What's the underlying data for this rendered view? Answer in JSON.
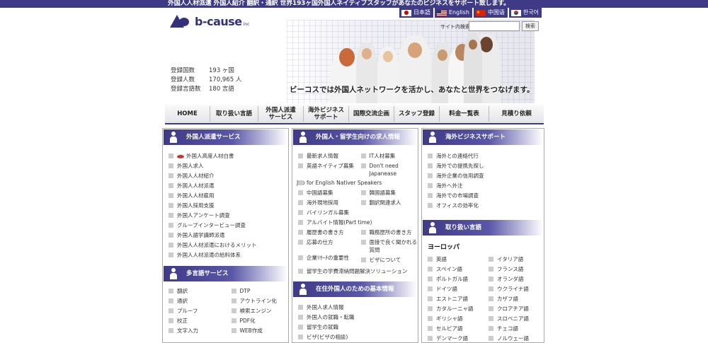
{
  "header": {
    "top_message": "外国人人材派遣 外国人紹介 翻訳・通訳 世界193ヶ国外国人ネイティブスタッフがあなたのビジネスをサポート致します。",
    "languages": [
      "日本語",
      "English",
      "中国语",
      "한국어"
    ],
    "logo_text": "b-cause",
    "logo_suffix": "inc",
    "search_label": "サイト内検索",
    "search_value": "",
    "search_button": "検索",
    "tagline": "ビーコスでは外国人ネットワークを活かし、あなたと世界をつなげます。"
  },
  "stats": [
    {
      "label": "登録国数",
      "value": "193 ヶ国"
    },
    {
      "label": "登録人数",
      "value": "170,965 人"
    },
    {
      "label": "登録言語数",
      "value": "180 言語"
    }
  ],
  "nav": [
    "HOME",
    "取り扱い言語",
    "外国人派遣\nサービス",
    "海外ビジネス\nサポート",
    "国際交流企画",
    "スタッフ登録",
    "料金一覧表",
    "見積り依頼"
  ],
  "col1": {
    "dispatch_title": "外国人派遣サービス",
    "dispatch_links": [
      "外国人高度人材白書",
      "外国人求人",
      "外国人人材紹介",
      "外国人人材派遣",
      "外国人人材雇用",
      "外国人採用支援",
      "外国人アンケート調査",
      "グループインタービュー調査",
      "外国人語学講師派遣",
      "外国人人材派遣におけるメリット",
      "外国人人材派遣の給料体系"
    ],
    "multi_title": "多言語サービス",
    "multi_links": [
      "翻訳",
      "DTP",
      "通訳",
      "アウトライン化",
      "プルーフ",
      "検索エンジン",
      "校正",
      "PDF化",
      "文字入力",
      "WEB作成"
    ]
  },
  "col2": {
    "jobs_title": "外国人・留学生向けの求人情報",
    "jobs_links_pairs": [
      "最新求人情報",
      "IT人材募集",
      "英語ネイティブ募集",
      "Don't need Japanease"
    ],
    "jobs_full": "Job for English Nativer Speakers",
    "jobs_links_pairs2": [
      "中国語募集",
      "韓国語募集",
      "海外現地採用",
      "翻訳関連求人"
    ],
    "jobs_single1": "バイリンガル募集",
    "jobs_single2": "アルバイト情報(Part time)",
    "jobs_links_pairs3": [
      "履歴書の書き方",
      "職務歴所の書き方",
      "応募の仕方",
      "面接で良く聞かれる質問",
      "企業ﾘｻｰﾁの重要性",
      "ビザについて"
    ],
    "jobs_single3": "留学生の学費滞納問題解決ソリューション",
    "basic_title": "在住外国人のための基本情報",
    "basic_links": [
      "外国人求人情報",
      "外国人の就職・転職",
      "留学生の就職",
      "ビザ(ビザの相談)"
    ]
  },
  "col3": {
    "biz_title": "海外ビジネスサポート",
    "biz_links": [
      "海外との連絡代行",
      "海外での提携先探し",
      "海外企業の信用調査",
      "海外へ外注",
      "海外での市場調査",
      "オフィスの効率化"
    ],
    "lang_title": "取り扱い言語",
    "region": "ヨーロッパ",
    "lang_links": [
      "英語",
      "イタリア語",
      "スペイン語",
      "フランス語",
      "ポルトガル語",
      "オランダ語",
      "ドイツ語",
      "ウクライナ語",
      "エストニア語",
      "カザフ語",
      "カタルーニャ語",
      "クロアチア語",
      "ギリシャ語",
      "スロベニア語",
      "セルビア語",
      "チェコ語",
      "デンマーク語",
      "ノルウェー語"
    ]
  }
}
